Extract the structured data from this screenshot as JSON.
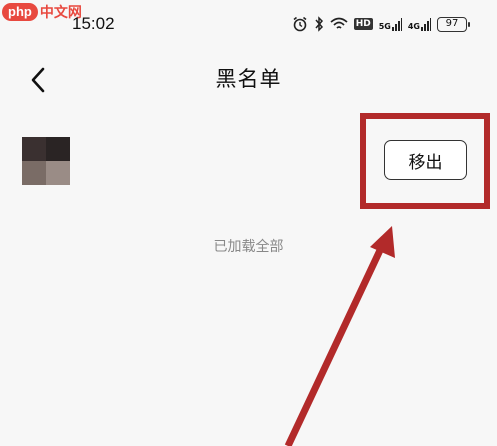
{
  "watermark": {
    "logo": "php",
    "text": "中文网"
  },
  "status_bar": {
    "time": "15:02",
    "icons": [
      "alarm-icon",
      "bluetooth-icon",
      "wifi-icon",
      "hd-icon",
      "signal-5g-icon",
      "signal-4g-icon",
      "battery-icon"
    ],
    "hd": "HD",
    "net1": "5G",
    "net2": "4G",
    "battery": "97"
  },
  "header": {
    "back_icon": "chevron-left-icon",
    "title": "黑名单"
  },
  "list": {
    "items": [
      {
        "action_label": "移出"
      }
    ],
    "footer": "已加载全部"
  },
  "annotation": {
    "color": "#b22a2a"
  }
}
